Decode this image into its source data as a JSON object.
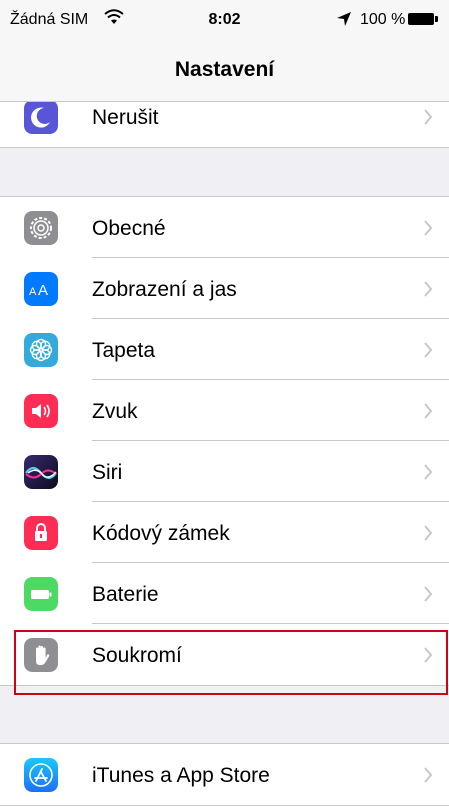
{
  "status_bar": {
    "carrier": "Žádná SIM",
    "time": "8:02",
    "battery": "100 %",
    "icons": [
      "wifi-icon",
      "location-arrow-icon",
      "battery-icon"
    ]
  },
  "nav": {
    "title": "Nastavení"
  },
  "groups": [
    {
      "items": [
        {
          "label": "Nerušit",
          "icon": "moon-icon",
          "color": "#5856d6"
        }
      ]
    },
    {
      "items": [
        {
          "label": "Obecné",
          "icon": "gear-icon",
          "color": "#8e8e93"
        },
        {
          "label": "Zobrazení a jas",
          "icon": "text-size-icon",
          "color": "#007aff"
        },
        {
          "label": "Tapeta",
          "icon": "flower-icon",
          "color": "#34aadc"
        },
        {
          "label": "Zvuk",
          "icon": "speaker-icon",
          "color": "#ff2d55"
        },
        {
          "label": "Siri",
          "icon": "siri-icon",
          "color": "#1c1c3c"
        },
        {
          "label": "Kódový zámek",
          "icon": "lock-icon",
          "color": "#ff2d55"
        },
        {
          "label": "Baterie",
          "icon": "battery-icon",
          "color": "#4cd964"
        },
        {
          "label": "Soukromí",
          "icon": "hand-icon",
          "color": "#8e8e93",
          "highlighted": true
        }
      ]
    },
    {
      "items": [
        {
          "label": "iTunes a App Store",
          "icon": "app-store-icon",
          "color": "#1e88f5"
        }
      ]
    }
  ]
}
